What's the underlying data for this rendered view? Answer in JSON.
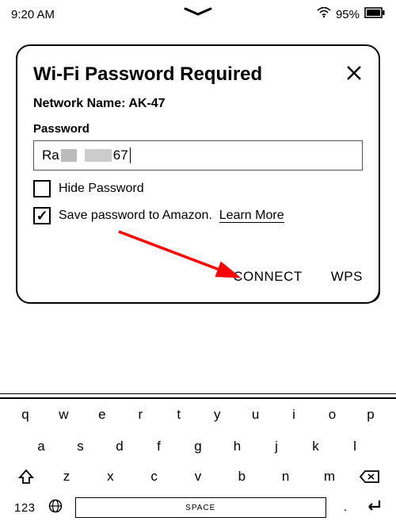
{
  "status": {
    "time": "9:20 AM",
    "battery": "95%"
  },
  "dialog": {
    "title": "Wi-Fi Password Required",
    "network_label": "Network Name: AK-47",
    "password_label": "Password",
    "password_prefix": "Ra",
    "password_suffix": "67",
    "hide_label": "Hide Password",
    "save_label": "Save password to Amazon.",
    "learn_more": "Learn More",
    "connect": "CONNECT",
    "wps": "WPS"
  },
  "keyboard": {
    "row1": [
      "q",
      "w",
      "e",
      "r",
      "t",
      "y",
      "u",
      "i",
      "o",
      "p"
    ],
    "row2": [
      "a",
      "s",
      "d",
      "f",
      "g",
      "h",
      "j",
      "k",
      "l"
    ],
    "row3": [
      "z",
      "x",
      "c",
      "v",
      "b",
      "n",
      "m"
    ],
    "numkey": "123",
    "space": "SPACE",
    "dot": "."
  }
}
